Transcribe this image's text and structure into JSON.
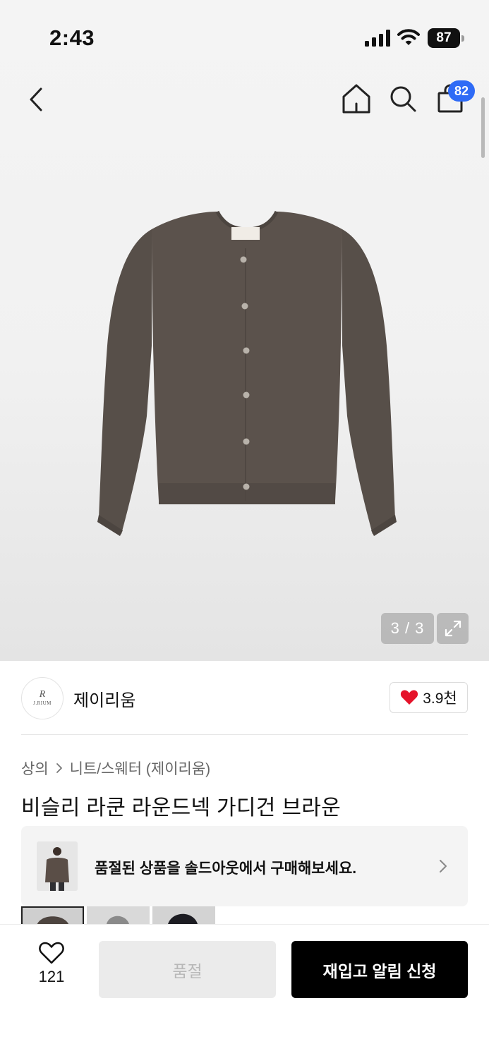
{
  "status_bar": {
    "time": "2:43",
    "battery": "87"
  },
  "nav": {
    "back_icon": "chevron-left-icon",
    "home_icon": "home-icon",
    "search_icon": "search-icon",
    "cart_icon": "shopping-bag-icon",
    "cart_count": "82"
  },
  "gallery": {
    "counter": "3 / 3",
    "expand_icon": "expand-icon",
    "product_color": "#5b524c"
  },
  "brand": {
    "name": "제이리움",
    "logo_text": "J.RIUM",
    "like_count": "3.9천",
    "like_icon": "heart-filled-icon",
    "like_color": "#e5132a"
  },
  "breadcrumb": [
    "상의",
    "니트/스웨터 (제이리움)"
  ],
  "product": {
    "title": "비슬리 라쿤 라운드넥 가디건 브라운"
  },
  "soldout_banner": {
    "text": "품절된 상품을 솔드아웃에서 구매해보세요."
  },
  "bottom_bar": {
    "wish_icon": "heart-outline-icon",
    "wish_count": "121",
    "soldout_label": "품절",
    "restock_label": "재입고 알림 신청"
  }
}
